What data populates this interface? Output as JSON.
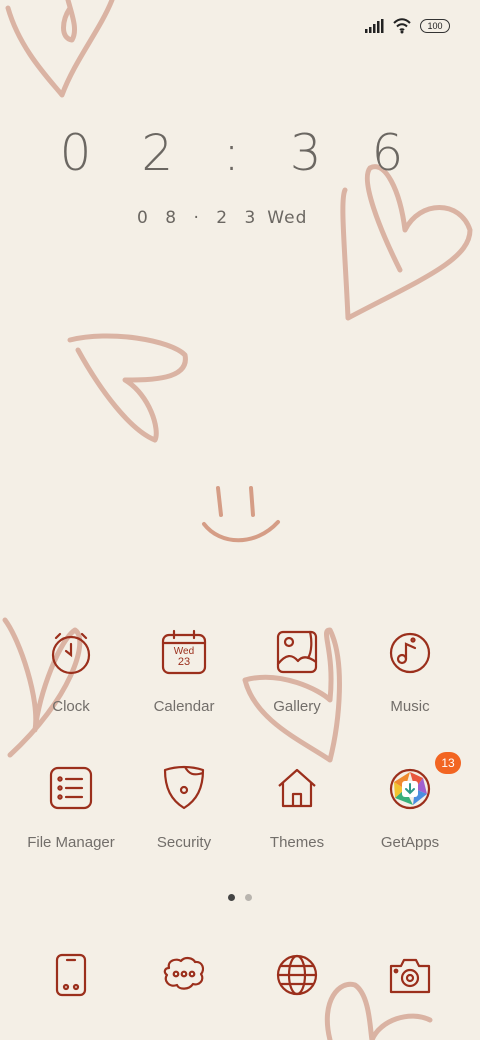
{
  "status_bar": {
    "battery": "100"
  },
  "clock": {
    "time": "0 2 : 3 6",
    "date": "0 8 · 2 3",
    "weekday": "Wed"
  },
  "calendar_icon": {
    "weekday": "Wed",
    "day": "23"
  },
  "apps_row1": [
    {
      "label": "Clock",
      "icon": "clock-icon"
    },
    {
      "label": "Calendar",
      "icon": "calendar-icon"
    },
    {
      "label": "Gallery",
      "icon": "gallery-icon"
    },
    {
      "label": "Music",
      "icon": "music-icon"
    }
  ],
  "apps_row2": [
    {
      "label": "File Manager",
      "icon": "file-manager-icon"
    },
    {
      "label": "Security",
      "icon": "security-shield-icon"
    },
    {
      "label": "Themes",
      "icon": "house-icon"
    },
    {
      "label": "GetApps",
      "icon": "getapps-icon",
      "badge": "13"
    }
  ],
  "page_indicator": {
    "pages": 2,
    "current": 1
  },
  "dock": [
    {
      "icon": "phone-icon"
    },
    {
      "icon": "messages-icon"
    },
    {
      "icon": "browser-globe-icon"
    },
    {
      "icon": "camera-icon"
    }
  ],
  "colors": {
    "background": "#f4efe6",
    "icon_stroke": "#9b2f1c",
    "heart": "#dcb4a4",
    "badge": "#f26522"
  }
}
